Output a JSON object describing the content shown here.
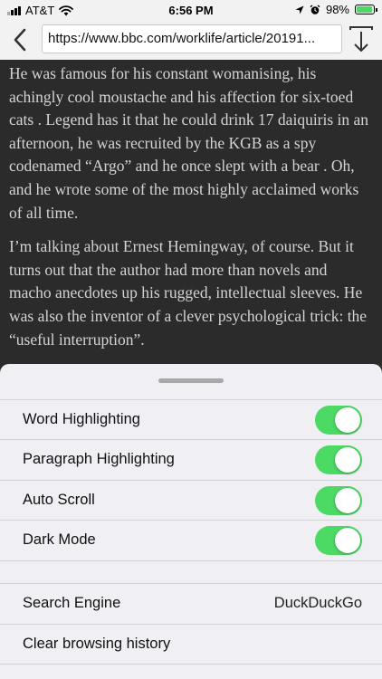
{
  "status_bar": {
    "carrier": "AT&T",
    "time": "6:56 PM",
    "battery_percent": "98%",
    "battery_level": 0.98,
    "accent_green": "#4cd964"
  },
  "toolbar": {
    "back_icon": "chevron-left-icon",
    "url": "https://www.bbc.com/worklife/article/20191...",
    "download_icon": "download-icon"
  },
  "article": {
    "paragraphs": [
      "He was famous for his constant womanising, his achingly cool moustache and his affection for six-toed cats . Legend has it that he could drink 17 daiquiris in an afternoon, he was recruited by the KGB as a spy codenamed “Argo” and he once slept with a bear . Oh, and he wrote some of the most highly acclaimed works of all time.",
      "I’m talking about Ernest Hemingway, of course. But it turns out that the author had more than novels and macho anecdotes up his rugged, intellectual sleeves. He was also the inventor of a clever psychological trick: the “useful interruption”."
    ]
  },
  "settings": {
    "toggles": [
      {
        "label": "Word Highlighting",
        "on": true
      },
      {
        "label": "Paragraph Highlighting",
        "on": true
      },
      {
        "label": "Auto Scroll",
        "on": true
      },
      {
        "label": "Dark Mode",
        "on": true
      }
    ],
    "search_engine": {
      "label": "Search Engine",
      "value": "DuckDuckGo"
    },
    "clear_history": {
      "label": "Clear browsing history"
    }
  }
}
